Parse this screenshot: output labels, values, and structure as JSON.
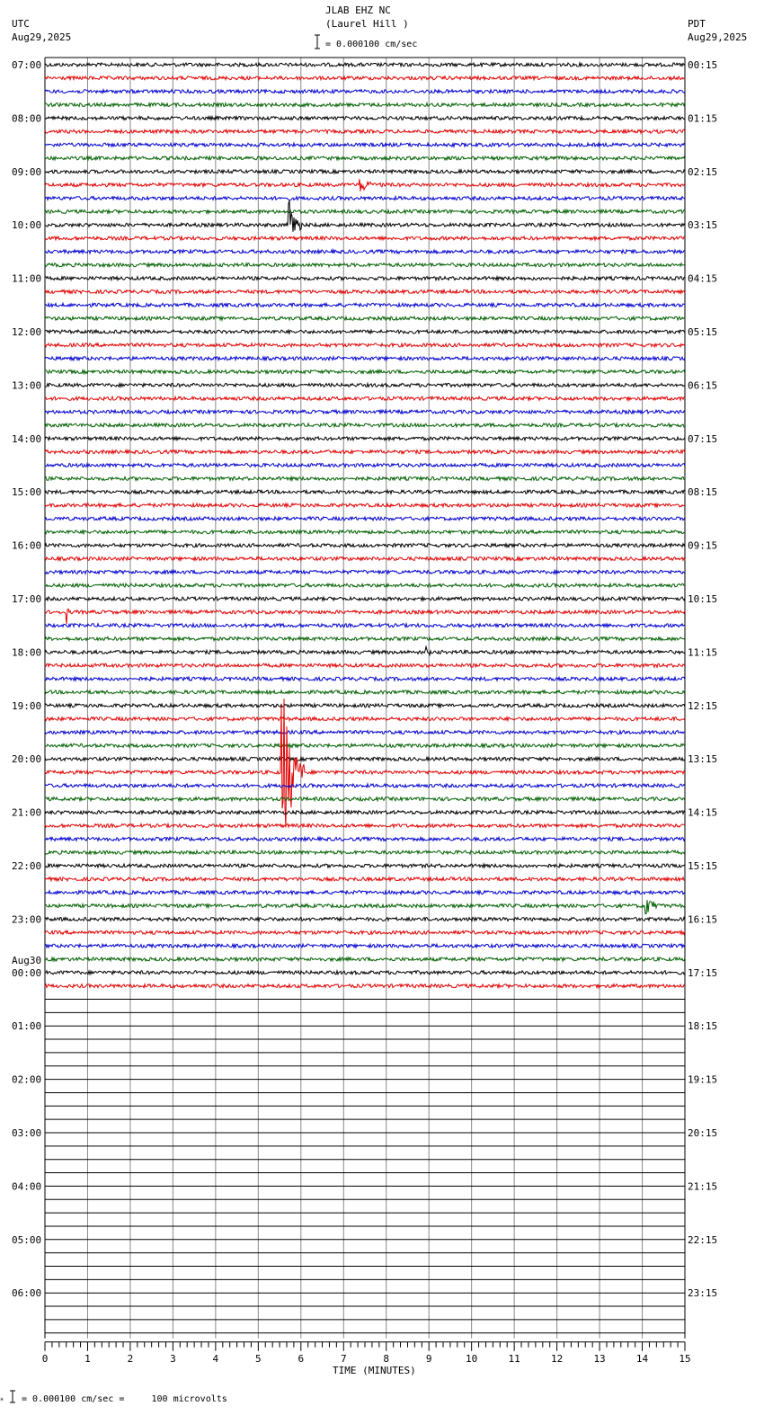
{
  "chart_data": {
    "type": "line",
    "subtype": "seismogram-helicorder",
    "title": "JLAB EHZ NC",
    "subtitle": "(Laurel Hill )",
    "scale_label": "= 0.000100 cm/sec",
    "left_tz": "UTC",
    "left_date": "Aug29,2025",
    "right_tz": "PDT",
    "right_date": "Aug29,2025",
    "date_change_label": "Aug30",
    "xlabel": "TIME (MINUTES)",
    "xlim": [
      0,
      15
    ],
    "x_ticks": [
      "0",
      "1",
      "2",
      "3",
      "4",
      "5",
      "6",
      "7",
      "8",
      "9",
      "10",
      "11",
      "12",
      "13",
      "14",
      "15"
    ],
    "left_hour_labels": [
      "07:00",
      "08:00",
      "09:00",
      "10:00",
      "11:00",
      "12:00",
      "13:00",
      "14:00",
      "15:00",
      "16:00",
      "17:00",
      "18:00",
      "19:00",
      "20:00",
      "21:00",
      "22:00",
      "23:00",
      "00:00",
      "01:00",
      "02:00",
      "03:00",
      "04:00",
      "05:00",
      "06:00"
    ],
    "right_hour_labels": [
      "00:15",
      "01:15",
      "02:15",
      "03:15",
      "04:15",
      "05:15",
      "06:15",
      "07:15",
      "08:15",
      "09:15",
      "10:15",
      "11:15",
      "12:15",
      "13:15",
      "14:15",
      "15:15",
      "16:15",
      "17:15",
      "18:15",
      "19:15",
      "20:15",
      "21:15",
      "22:15",
      "23:15"
    ],
    "traces_per_hour": 4,
    "total_traces": 96,
    "recorded_traces": 70,
    "trace_colors": [
      "#000000",
      "#e00000",
      "#0000d0",
      "#006000"
    ],
    "events": [
      {
        "trace": 9,
        "minute": 7.37,
        "amplitude": 0.6,
        "duration": 0.7
      },
      {
        "trace": 12,
        "minute": 5.69,
        "amplitude": 3.0,
        "duration": 0.35
      },
      {
        "trace": 41,
        "minute": 0.5,
        "amplitude": 1.0,
        "duration": 0.1
      },
      {
        "trace": 44,
        "minute": 8.93,
        "amplitude": 0.7,
        "duration": 0.15
      },
      {
        "trace": 53,
        "minute": 5.54,
        "amplitude": 8.0,
        "duration": 0.6
      },
      {
        "trace": 63,
        "minute": 14.07,
        "amplitude": 1.0,
        "duration": 0.4
      }
    ],
    "footer": "= 0.000100 cm/sec =     100 microvolts"
  }
}
